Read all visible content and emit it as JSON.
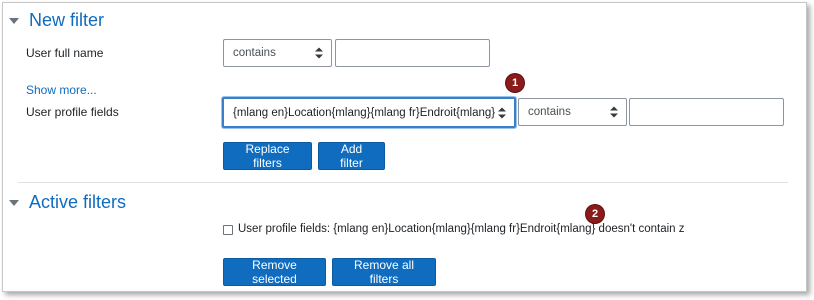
{
  "new_filter": {
    "title": "New filter",
    "user_full_name": {
      "label": "User full name",
      "operator": "contains",
      "value": ""
    },
    "show_more": "Show more...",
    "profile_fields": {
      "label": "User profile fields",
      "field": "{mlang en}Location{mlang}{mlang fr}Endroit{mlang}",
      "operator": "contains",
      "value": ""
    },
    "replace_button": "Replace filters",
    "add_button": "Add filter"
  },
  "active_filters": {
    "title": "Active filters",
    "items": [
      {
        "text": "User profile fields: {mlang en}Location{mlang}{mlang fr}Endroit{mlang} doesn't contain z",
        "checked": false
      }
    ],
    "remove_selected_button": "Remove selected",
    "remove_all_button": "Remove all filters"
  },
  "annotations": {
    "marker_1": "1",
    "marker_2": "2",
    "color": "#8b1a1a"
  },
  "colors": {
    "accent": "#0f6cbf",
    "focus": "#3a7fc8"
  }
}
